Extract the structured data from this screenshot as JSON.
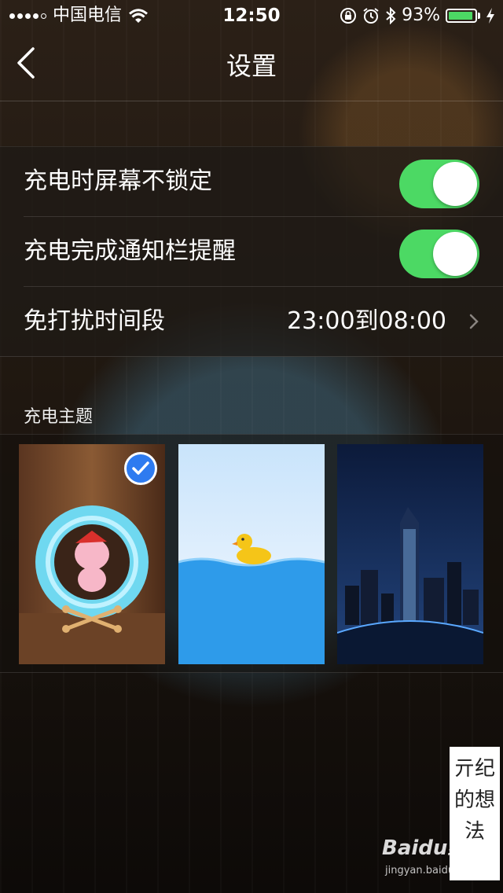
{
  "status_bar": {
    "carrier": "中国电信",
    "time": "12:50",
    "battery_percent": "93%",
    "battery_level": 0.93,
    "icons": [
      "signal-icon",
      "wifi-icon",
      "orientation-lock-icon",
      "alarm-icon",
      "bluetooth-icon",
      "battery-icon",
      "charging-icon"
    ]
  },
  "nav": {
    "title": "设置",
    "back_icon": "chevron-left-icon"
  },
  "settings": {
    "rows": [
      {
        "label": "充电时屏幕不锁定",
        "toggle_on": true
      },
      {
        "label": "充电完成通知栏提醒",
        "toggle_on": true
      },
      {
        "label": "免打扰时间段",
        "value": "23:00到08:00"
      }
    ]
  },
  "themes": {
    "section_title": "充电主题",
    "items": [
      {
        "name": "bunny-wheel",
        "selected": true
      },
      {
        "name": "rubber-duck",
        "selected": false
      },
      {
        "name": "night-city",
        "selected": false
      }
    ]
  },
  "watermark": {
    "text": "亓纪的想法",
    "brand": "Baidu经验",
    "url": "jingyan.baidu.com"
  },
  "colors": {
    "toggle_on": "#4cd964",
    "check_blue": "#2e7bf0"
  }
}
